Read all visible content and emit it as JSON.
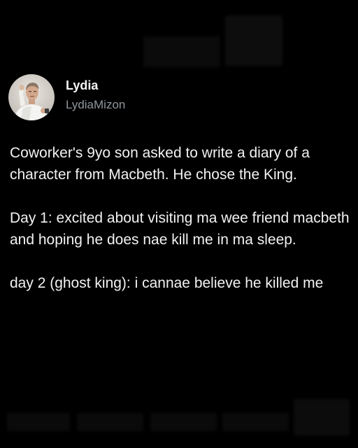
{
  "post": {
    "author": {
      "display_name": "Lydia",
      "handle": "LydiaMizon",
      "avatar_icon": "profile-photo"
    },
    "paragraphs": [
      "Coworker's 9yo son asked to write a diary of a character from Macbeth. He chose the King.",
      "Day 1: excited about visiting ma wee friend macbeth and hoping he does nae kill me in ma sleep.",
      "day 2 (ghost king):  i cannae believe he killed me"
    ]
  },
  "colors": {
    "background": "#000000",
    "text_primary": "#f2f2f2",
    "text_secondary": "#8f969c"
  }
}
